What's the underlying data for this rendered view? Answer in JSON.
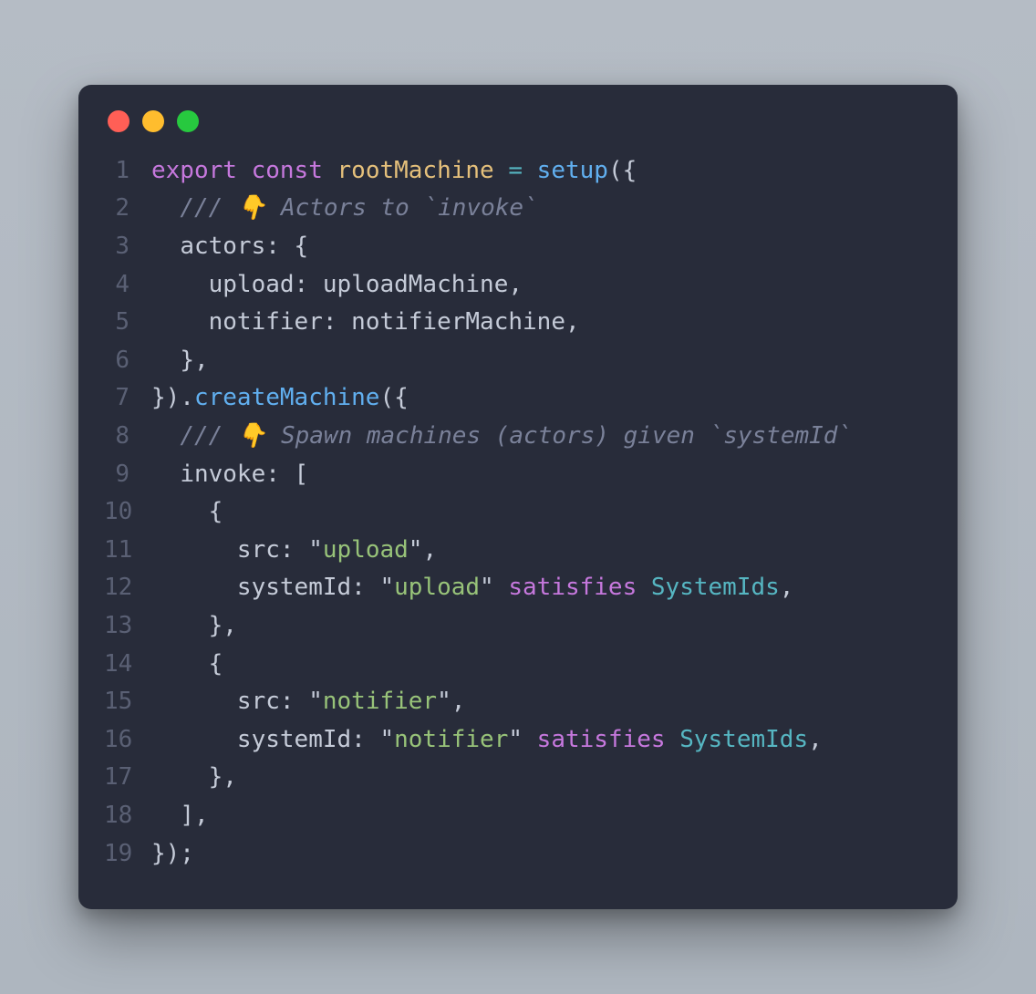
{
  "traffic_lights": {
    "red": "#ff5f56",
    "yellow": "#ffbd2e",
    "green": "#27c93f"
  },
  "line_numbers": [
    "1",
    "2",
    "3",
    "4",
    "5",
    "6",
    "7",
    "8",
    "9",
    "10",
    "11",
    "12",
    "13",
    "14",
    "15",
    "16",
    "17",
    "18",
    "19"
  ],
  "code": {
    "l1": {
      "export": "export",
      "const": "const",
      "rootMachine": "rootMachine",
      "eq": " = ",
      "setup": "setup",
      "open": "({"
    },
    "l2": {
      "indent": "  ",
      "comment": "/// 👇 Actors to `invoke`"
    },
    "l3": {
      "indent": "  ",
      "prop": "actors",
      "rest": ": {"
    },
    "l4": {
      "indent": "    ",
      "prop": "upload",
      "rest": ": uploadMachine,"
    },
    "l5": {
      "indent": "    ",
      "prop": "notifier",
      "rest": ": notifierMachine,"
    },
    "l6": {
      "indent": "  ",
      "rest": "},"
    },
    "l7": {
      "close": "}).",
      "createMachine": "createMachine",
      "open": "({"
    },
    "l8": {
      "indent": "  ",
      "comment": "/// 👇 Spawn machines (actors) given `systemId`"
    },
    "l9": {
      "indent": "  ",
      "prop": "invoke",
      "rest": ": ["
    },
    "l10": {
      "indent": "    ",
      "rest": "{"
    },
    "l11": {
      "indent": "      ",
      "prop": "src",
      "colon": ": ",
      "q1": "\"",
      "str": "upload",
      "q2": "\"",
      "comma": ","
    },
    "l12": {
      "indent": "      ",
      "prop": "systemId",
      "colon": ": ",
      "q1": "\"",
      "str": "upload",
      "q2": "\"",
      "sp": " ",
      "satisfies": "satisfies",
      "sp2": " ",
      "type": "SystemIds",
      "comma": ","
    },
    "l13": {
      "indent": "    ",
      "rest": "},"
    },
    "l14": {
      "indent": "    ",
      "rest": "{"
    },
    "l15": {
      "indent": "      ",
      "prop": "src",
      "colon": ": ",
      "q1": "\"",
      "str": "notifier",
      "q2": "\"",
      "comma": ","
    },
    "l16": {
      "indent": "      ",
      "prop": "systemId",
      "colon": ": ",
      "q1": "\"",
      "str": "notifier",
      "q2": "\"",
      "sp": " ",
      "satisfies": "satisfies",
      "sp2": " ",
      "type": "SystemIds",
      "comma": ","
    },
    "l17": {
      "indent": "    ",
      "rest": "},"
    },
    "l18": {
      "indent": "  ",
      "rest": "],"
    },
    "l19": {
      "rest": "});"
    }
  }
}
